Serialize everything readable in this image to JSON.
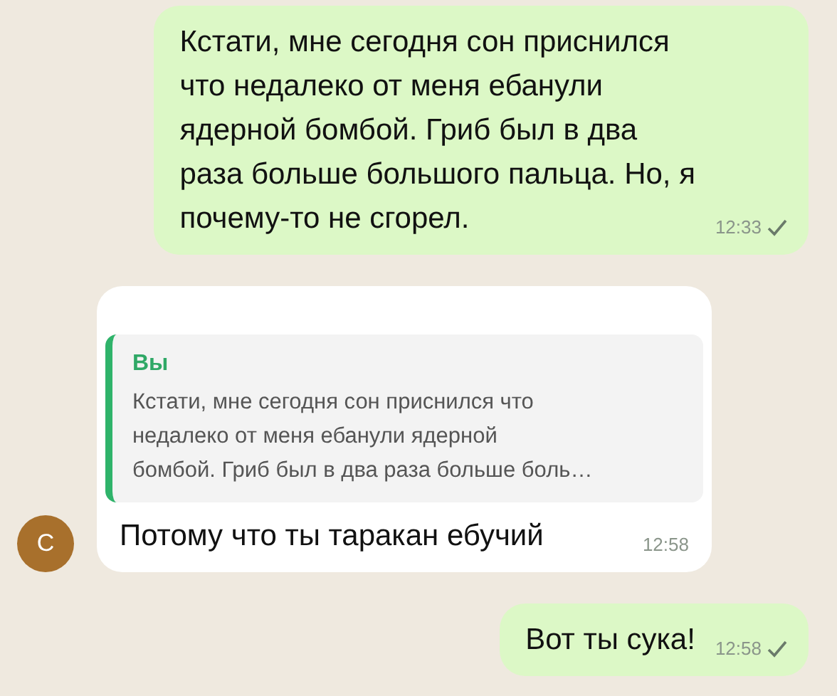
{
  "messages": [
    {
      "kind": "outgoing",
      "lines": [
        "Кстати, мне сегодня сон приснился",
        "что недалеко от меня ебанули",
        "ядерной бомбой. Гриб был в два",
        "раза больше большого пальца. Но, я",
        "почему-то не сгорел."
      ],
      "time": "12:33",
      "delivered": true
    },
    {
      "kind": "incoming",
      "avatar": {
        "letter": "С",
        "color": "#a8702c"
      },
      "reply": {
        "author": "Вы",
        "lines": [
          "Кстати, мне сегодня сон приснился что",
          "недалеко от меня ебанули ядерной",
          "бомбой. Гриб был в два раза больше боль…"
        ]
      },
      "lines": [
        "Потому что ты таракан ебучий"
      ],
      "time": "12:58"
    },
    {
      "kind": "outgoing",
      "lines": [
        "Вот ты сука!"
      ],
      "time": "12:58",
      "delivered": true
    }
  ]
}
